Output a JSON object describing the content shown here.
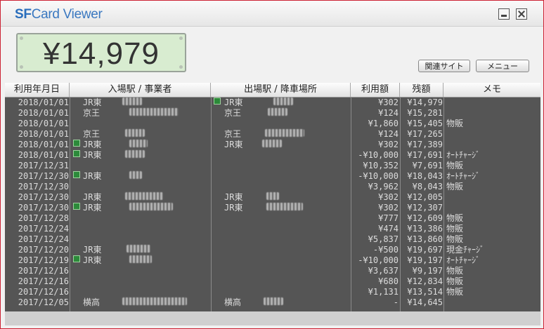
{
  "app": {
    "logo_bold": "SF",
    "logo_rest": "Card Viewer",
    "icons": {
      "minimize": "minimize-icon",
      "close": "close-icon"
    }
  },
  "balance": "¥14,979",
  "buttons": {
    "related": "関連サイト",
    "menu": "メニュー"
  },
  "table": {
    "headers": [
      "利用年月日",
      "入場駅 / 事業者",
      "出場駅 / 降車場所",
      "利用額",
      "残額",
      "メモ"
    ],
    "rows": [
      {
        "date": "2018/01/01",
        "in_mark": false,
        "in_station": "JR東",
        "out_mark": true,
        "out_station": "JR東",
        "use": "¥302",
        "balance": "¥14,979",
        "memo": ""
      },
      {
        "date": "2018/01/01",
        "in_mark": false,
        "in_station": "京王",
        "out_mark": false,
        "out_station": "京王",
        "use": "¥124",
        "balance": "¥15,281",
        "memo": ""
      },
      {
        "date": "2018/01/01",
        "in_mark": false,
        "in_station": "",
        "out_mark": false,
        "out_station": "",
        "use": "¥1,860",
        "balance": "¥15,405",
        "memo": "物販"
      },
      {
        "date": "2018/01/01",
        "in_mark": false,
        "in_station": "京王",
        "out_mark": false,
        "out_station": "京王",
        "use": "¥124",
        "balance": "¥17,265",
        "memo": ""
      },
      {
        "date": "2018/01/01",
        "in_mark": true,
        "in_station": "JR東",
        "out_mark": false,
        "out_station": "JR東",
        "use": "¥302",
        "balance": "¥17,389",
        "memo": ""
      },
      {
        "date": "2018/01/01",
        "in_mark": true,
        "in_station": "JR東",
        "out_mark": false,
        "out_station": "",
        "use": "-¥10,000",
        "balance": "¥17,691",
        "memo": "ｵｰﾄﾁｬｰｼﾞ"
      },
      {
        "date": "2017/12/31",
        "in_mark": false,
        "in_station": "",
        "out_mark": false,
        "out_station": "",
        "use": "¥10,352",
        "balance": "¥7,691",
        "memo": "物販"
      },
      {
        "date": "2017/12/30",
        "in_mark": true,
        "in_station": "JR東",
        "out_mark": false,
        "out_station": "",
        "use": "-¥10,000",
        "balance": "¥18,043",
        "memo": "ｵｰﾄﾁｬｰｼﾞ"
      },
      {
        "date": "2017/12/30",
        "in_mark": false,
        "in_station": "",
        "out_mark": false,
        "out_station": "",
        "use": "¥3,962",
        "balance": "¥8,043",
        "memo": "物販"
      },
      {
        "date": "2017/12/30",
        "in_mark": false,
        "in_station": "JR東",
        "out_mark": false,
        "out_station": "JR東",
        "use": "¥302",
        "balance": "¥12,005",
        "memo": ""
      },
      {
        "date": "2017/12/30",
        "in_mark": true,
        "in_station": "JR東",
        "out_mark": false,
        "out_station": "JR東",
        "use": "¥302",
        "balance": "¥12,307",
        "memo": ""
      },
      {
        "date": "2017/12/28",
        "in_mark": false,
        "in_station": "",
        "out_mark": false,
        "out_station": "",
        "use": "¥777",
        "balance": "¥12,609",
        "memo": "物販"
      },
      {
        "date": "2017/12/24",
        "in_mark": false,
        "in_station": "",
        "out_mark": false,
        "out_station": "",
        "use": "¥474",
        "balance": "¥13,386",
        "memo": "物販"
      },
      {
        "date": "2017/12/24",
        "in_mark": false,
        "in_station": "",
        "out_mark": false,
        "out_station": "",
        "use": "¥5,837",
        "balance": "¥13,860",
        "memo": "物販"
      },
      {
        "date": "2017/12/20",
        "in_mark": false,
        "in_station": "JR東",
        "out_mark": false,
        "out_station": "",
        "use": "-¥500",
        "balance": "¥19,697",
        "memo": "現金ﾁｬｰｼﾞ"
      },
      {
        "date": "2017/12/19",
        "in_mark": true,
        "in_station": "JR東",
        "out_mark": false,
        "out_station": "",
        "use": "-¥10,000",
        "balance": "¥19,197",
        "memo": "ｵｰﾄﾁｬｰｼﾞ"
      },
      {
        "date": "2017/12/16",
        "in_mark": false,
        "in_station": "",
        "out_mark": false,
        "out_station": "",
        "use": "¥3,637",
        "balance": "¥9,197",
        "memo": "物販"
      },
      {
        "date": "2017/12/16",
        "in_mark": false,
        "in_station": "",
        "out_mark": false,
        "out_station": "",
        "use": "¥680",
        "balance": "¥12,834",
        "memo": "物販"
      },
      {
        "date": "2017/12/16",
        "in_mark": false,
        "in_station": "",
        "out_mark": false,
        "out_station": "",
        "use": "¥1,131",
        "balance": "¥13,514",
        "memo": "物販"
      },
      {
        "date": "2017/12/05",
        "in_mark": false,
        "in_station": "横高",
        "out_mark": false,
        "out_station": "横高",
        "use": "-",
        "balance": "¥14,645",
        "memo": ""
      }
    ]
  }
}
